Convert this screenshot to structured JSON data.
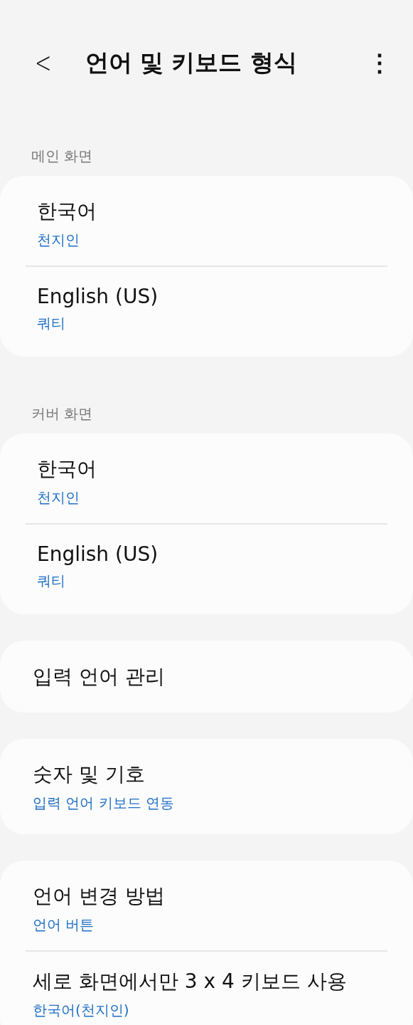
{
  "header": {
    "back": "<",
    "title": "언어 및 키보드 형식",
    "more": "⋮"
  },
  "sections": [
    {
      "label": "메인 화면",
      "items": [
        {
          "title": "한국어",
          "subtitle": "천지인"
        },
        {
          "title": "English (US)",
          "subtitle": "쿼티"
        }
      ]
    },
    {
      "label": "커버 화면",
      "items": [
        {
          "title": "한국어",
          "subtitle": "천지인"
        },
        {
          "title": "English (US)",
          "subtitle": "쿼티"
        }
      ]
    },
    {
      "items": [
        {
          "title": "입력 언어 관리"
        }
      ]
    },
    {
      "items": [
        {
          "title": "숫자 및 기호",
          "subtitle": "입력 언어 키보드 연동"
        }
      ]
    },
    {
      "items": [
        {
          "title": "언어 변경 방법",
          "subtitle": "언어 버튼"
        },
        {
          "title": "세로 화면에서만 3 x 4 키보드 사용",
          "subtitle": "한국어(천지인)"
        }
      ]
    }
  ]
}
